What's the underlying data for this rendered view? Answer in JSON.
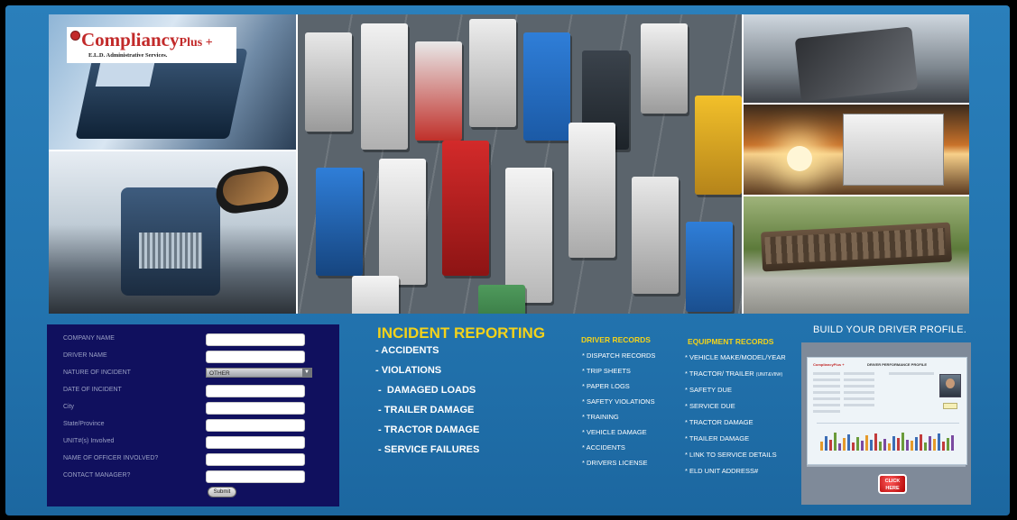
{
  "brand": {
    "name": "Compliancy",
    "name_suffix": "Plus +",
    "tagline": "E.L.D. Administrative Services."
  },
  "form": {
    "fields": [
      {
        "label": "COMPANY NAME",
        "type": "text",
        "value": ""
      },
      {
        "label": "DRIVER NAME",
        "type": "text",
        "value": ""
      },
      {
        "label": "NATURE OF INCIDENT",
        "type": "select",
        "value": "OTHER"
      },
      {
        "label": "DATE OF INCIDENT",
        "type": "text",
        "value": ""
      },
      {
        "label": "City",
        "type": "text",
        "value": ""
      },
      {
        "label": "State/Province",
        "type": "text",
        "value": ""
      },
      {
        "label": "UNIT#(s) Involved",
        "type": "text",
        "value": ""
      },
      {
        "label": "NAME OF OFFICER INVOLVED?",
        "type": "text",
        "value": ""
      },
      {
        "label": "CONTACT MANAGER?",
        "type": "text",
        "value": ""
      }
    ],
    "submit_label": "Submit"
  },
  "incident": {
    "title": "INCIDENT REPORTING",
    "items": [
      "- ACCIDENTS",
      "- VIOLATIONS",
      " -  DAMAGED LOADS",
      " - TRAILER DAMAGE",
      " - TRACTOR DAMAGE",
      " - SERVICE FAILURES"
    ]
  },
  "driver_records": {
    "title": "DRIVER RECORDS",
    "items": [
      "* DISPATCH RECORDS",
      "* TRIP SHEETS",
      "* PAPER LOGS",
      "* SAFETY VIOLATIONS",
      "* TRAINING",
      "* VEHICLE DAMAGE",
      "* ACCIDENTS",
      "* DRIVERS LICENSE"
    ]
  },
  "equipment_records": {
    "title": "EQUIPMENT RECORDS",
    "items": [
      "* VEHICLE MAKE/MODEL/YEAR",
      "* TRACTOR/ TRAILER",
      "* SAFETY DUE",
      "* SERVICE DUE",
      "* TRACTOR DAMAGE",
      "* TRAILER DAMAGE",
      "* LINK TO SERVICE DETAILS",
      "* ELD UNIT ADDRESS#"
    ],
    "tractor_suffix": "(UNIT&VIN#)"
  },
  "profile": {
    "title": "BUILD YOUR DRIVER PROFILE.",
    "card_logo": "CompliancyPlus +",
    "card_title": "DRIVER PERFORMANCE PROFILE",
    "button_label": "CLICK HERE"
  },
  "colors": {
    "background": "#2273ae",
    "form_panel": "#10105e",
    "heading_yellow": "#f3d21a",
    "brand_red": "#c22a2a"
  }
}
